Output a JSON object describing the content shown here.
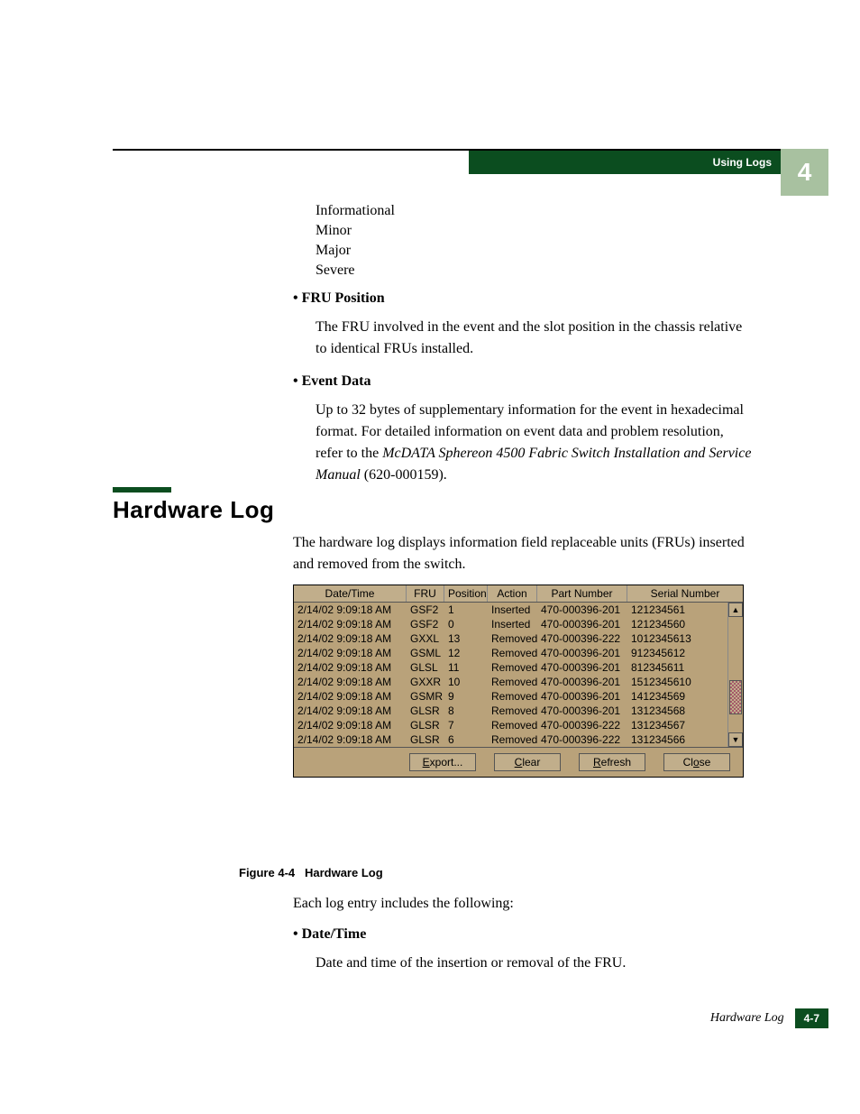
{
  "header": {
    "tab_label": "Using Logs",
    "chapter_number": "4"
  },
  "severity": {
    "info": "Informational",
    "minor": "Minor",
    "major": "Major",
    "severe": "Severe"
  },
  "fru_position": {
    "label": "FRU Position",
    "desc": "The FRU involved in the event and the slot position in the chassis relative to identical FRUs installed."
  },
  "event_data": {
    "label": "Event Data",
    "desc_pre": "Up to 32 bytes of supplementary information for the event in hexadecimal format. For detailed information on event data and problem resolution, refer to the ",
    "desc_em": "McDATA Sphereon 4500 Fabric Switch Installation and Service Manual",
    "desc_post": " (620-000159)."
  },
  "section": {
    "title": "Hardware Log",
    "intro": "The hardware log displays information field replaceable units (FRUs) inserted and removed from the switch."
  },
  "figure": {
    "caption_label": "Figure 4-4",
    "caption_text": "Hardware Log",
    "columns": {
      "dt": "Date/Time",
      "fru": "FRU",
      "pos": "Position",
      "act": "Action",
      "pn": "Part Number",
      "sn": "Serial Number"
    },
    "rows": [
      {
        "dt": "2/14/02 9:09:18 AM",
        "fru": "GSF2",
        "pos": "1",
        "act": "Inserted",
        "pn": "470-000396-201",
        "sn": "121234561"
      },
      {
        "dt": "2/14/02 9:09:18 AM",
        "fru": "GSF2",
        "pos": "0",
        "act": "Inserted",
        "pn": "470-000396-201",
        "sn": "121234560"
      },
      {
        "dt": "2/14/02 9:09:18 AM",
        "fru": "GXXL",
        "pos": "13",
        "act": "Removed",
        "pn": "470-000396-222",
        "sn": "1012345613"
      },
      {
        "dt": "2/14/02 9:09:18 AM",
        "fru": "GSML",
        "pos": "12",
        "act": "Removed",
        "pn": "470-000396-201",
        "sn": "912345612"
      },
      {
        "dt": "2/14/02 9:09:18 AM",
        "fru": "GLSL",
        "pos": "11",
        "act": "Removed",
        "pn": "470-000396-201",
        "sn": "812345611"
      },
      {
        "dt": "2/14/02 9:09:18 AM",
        "fru": "GXXR",
        "pos": "10",
        "act": "Removed",
        "pn": "470-000396-201",
        "sn": "1512345610"
      },
      {
        "dt": "2/14/02 9:09:18 AM",
        "fru": "GSMR",
        "pos": "9",
        "act": "Removed",
        "pn": "470-000396-201",
        "sn": "141234569"
      },
      {
        "dt": "2/14/02 9:09:18 AM",
        "fru": "GLSR",
        "pos": "8",
        "act": "Removed",
        "pn": "470-000396-201",
        "sn": "131234568"
      },
      {
        "dt": "2/14/02 9:09:18 AM",
        "fru": "GLSR",
        "pos": "7",
        "act": "Removed",
        "pn": "470-000396-222",
        "sn": "131234567"
      },
      {
        "dt": "2/14/02 9:09:18 AM",
        "fru": "GLSR",
        "pos": "6",
        "act": "Removed",
        "pn": "470-000396-222",
        "sn": "131234566"
      }
    ],
    "buttons": {
      "export": {
        "u": "E",
        "rest": "xport..."
      },
      "clear": {
        "u": "C",
        "rest": "lear"
      },
      "refresh": {
        "u": "R",
        "rest": "efresh"
      },
      "close": {
        "pre": "Cl",
        "u": "o",
        "rest": "se"
      }
    }
  },
  "after": {
    "intro": "Each log entry includes the following:",
    "dt_label": "Date/Time",
    "dt_desc": "Date and time of the insertion or removal of the FRU."
  },
  "footer": {
    "section": "Hardware Log",
    "page": "4-7"
  }
}
